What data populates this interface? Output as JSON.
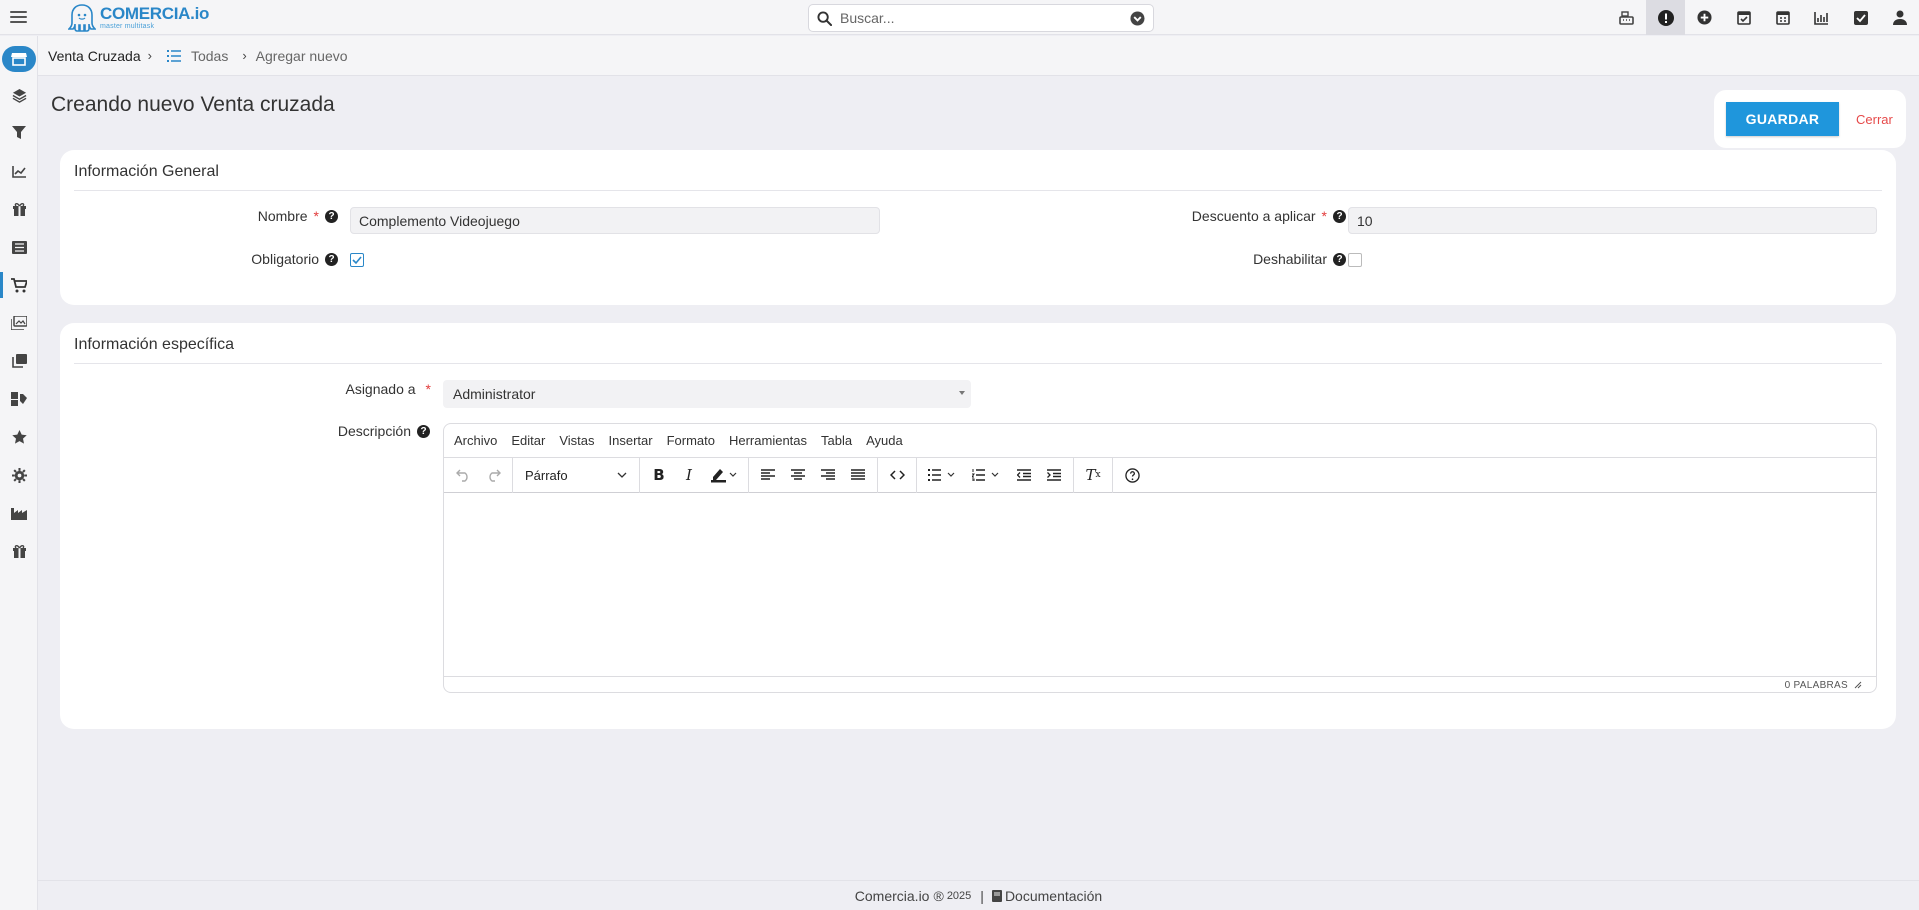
{
  "app": {
    "logo_name": "COMERCIA.io",
    "logo_tagline": "master multitask"
  },
  "search": {
    "placeholder": "Buscar..."
  },
  "topbar_icons": [
    "cash-register-icon",
    "alert-icon",
    "plus-circle-icon",
    "calendar-check-icon",
    "calendar-icon",
    "chart-icon",
    "checkbox-icon",
    "user-icon"
  ],
  "sidebar_icons": [
    "store-icon",
    "layers-icon",
    "filter-icon",
    "chart-line-icon",
    "gift-icon",
    "list-icon",
    "cart-icon",
    "image-icon",
    "copy-icon",
    "tags-icon",
    "star-icon",
    "gear-icon",
    "factory-icon",
    "gift-alt-icon"
  ],
  "breadcrumb": {
    "module": "Venta Cruzada",
    "list": "Todas",
    "current": "Agregar nuevo"
  },
  "page": {
    "title": "Creando nuevo Venta cruzada",
    "save_label": "GUARDAR",
    "close_label": "Cerrar"
  },
  "general": {
    "title": "Información General",
    "nombre_label": "Nombre",
    "nombre_value": "Complemento Videojuego",
    "descuento_label": "Descuento a aplicar",
    "descuento_value": "10",
    "obligatorio_label": "Obligatorio",
    "obligatorio_checked": true,
    "deshabilitar_label": "Deshabilitar",
    "deshabilitar_checked": false
  },
  "specific": {
    "title": "Información específica",
    "asignado_label": "Asignado a",
    "asignado_value": "Administrator",
    "descripcion_label": "Descripción"
  },
  "editor": {
    "menu": [
      "Archivo",
      "Editar",
      "Vistas",
      "Insertar",
      "Formato",
      "Herramientas",
      "Tabla",
      "Ayuda"
    ],
    "block_format": "Párrafo",
    "word_count": "0 PALABRAS"
  },
  "footer": {
    "brand": "Comercia.io",
    "copyright": "®",
    "year": "2025",
    "separator": "|",
    "docs": "Documentación"
  },
  "colors": {
    "accent": "#2a87c8",
    "save_button": "#1f96dc",
    "close_link": "#e64a4a",
    "required": "#e23b3b"
  }
}
